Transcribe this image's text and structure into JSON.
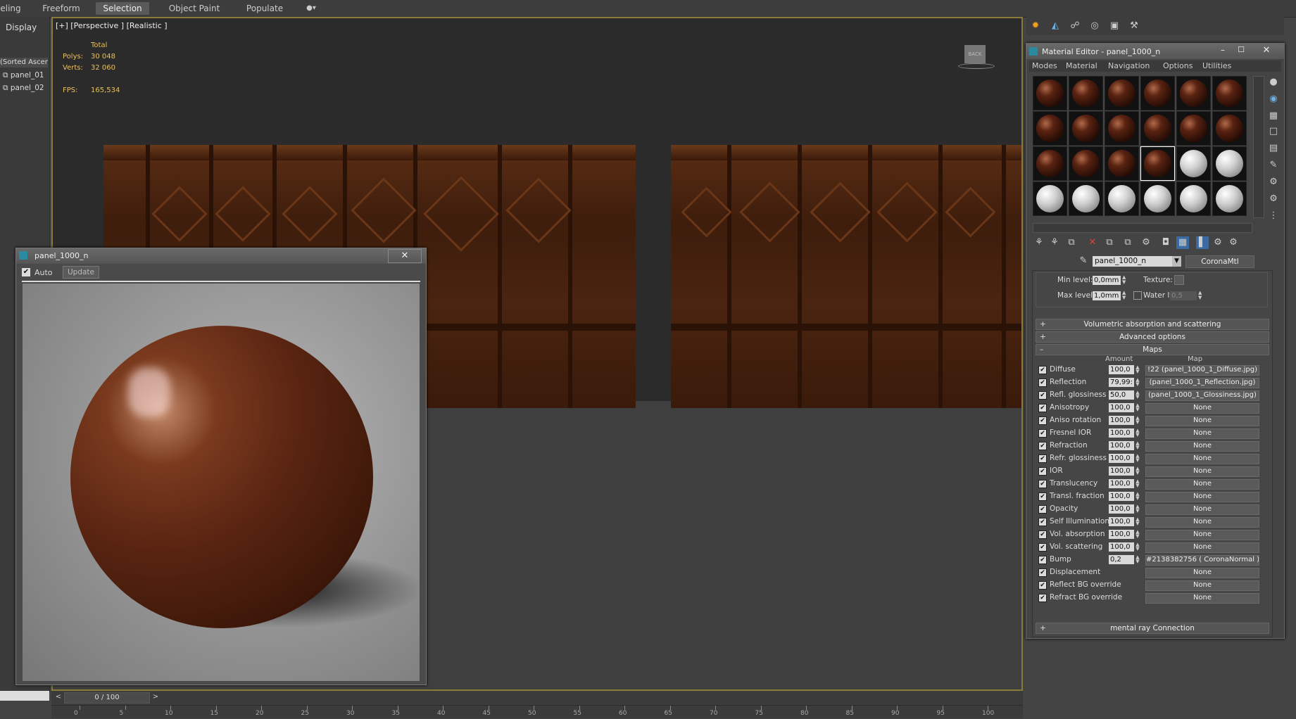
{
  "ribbon": {
    "tabs": [
      "eling",
      "Freeform",
      "Selection",
      "Object Paint",
      "Populate"
    ]
  },
  "left_panel": {
    "display_label": "Display",
    "sort_label": "(Sorted Ascen",
    "items": [
      "panel_01",
      "panel_02"
    ]
  },
  "viewport": {
    "label": "[+] [Perspective ] [Realistic ]",
    "stats": {
      "total_label": "Total",
      "polys_label": "Polys:",
      "polys_value": "30 048",
      "verts_label": "Verts:",
      "verts_value": "32 060",
      "fps_label": "FPS:",
      "fps_value": "165,534"
    },
    "viewcube_label": "BACK"
  },
  "render_window": {
    "title": "panel_1000_n",
    "auto_label": "Auto",
    "update_label": "Update"
  },
  "material_editor": {
    "title": "Material Editor - panel_1000_n",
    "menu": [
      "Modes",
      "Material",
      "Navigation",
      "Options",
      "Utilities"
    ],
    "slot_types": [
      "wood",
      "wood",
      "wood",
      "wood",
      "wood",
      "wood",
      "wood",
      "wood",
      "wood",
      "wood",
      "wood",
      "wood",
      "wood",
      "wood",
      "wood",
      "wood",
      "white",
      "white",
      "white",
      "white",
      "white",
      "white",
      "white",
      "white"
    ],
    "material_name": "panel_1000_n",
    "material_type": "CoronaMtl",
    "min_level_label": "Min level:",
    "min_level_value": "0,0mm",
    "max_level_label": "Max level:",
    "max_level_value": "1,0mm",
    "texture_label": "Texture:",
    "water_label": "Water lvl.",
    "water_value": "0,5",
    "rollouts": {
      "volumetric": "Volumetric absorption and scattering",
      "advanced": "Advanced options",
      "maps": "Maps",
      "mental_ray": "mental ray Connection"
    },
    "maps_header": {
      "amount": "Amount",
      "map": "Map"
    },
    "maps": [
      {
        "label": "Diffuse",
        "amount": "100,0",
        "map": "!22 (panel_1000_1_Diffuse.jpg)"
      },
      {
        "label": "Reflection",
        "amount": "79,99:",
        "map": "(panel_1000_1_Reflection.jpg)"
      },
      {
        "label": "Refl. glossiness",
        "amount": "50,0",
        "map": "(panel_1000_1_Glossiness.jpg)"
      },
      {
        "label": "Anisotropy",
        "amount": "100,0",
        "map": "None"
      },
      {
        "label": "Aniso rotation",
        "amount": "100,0",
        "map": "None"
      },
      {
        "label": "Fresnel IOR",
        "amount": "100,0",
        "map": "None"
      },
      {
        "label": "Refraction",
        "amount": "100,0",
        "map": "None"
      },
      {
        "label": "Refr. glossiness",
        "amount": "100,0",
        "map": "None"
      },
      {
        "label": "IOR",
        "amount": "100,0",
        "map": "None"
      },
      {
        "label": "Translucency",
        "amount": "100,0",
        "map": "None"
      },
      {
        "label": "Transl. fraction",
        "amount": "100,0",
        "map": "None"
      },
      {
        "label": "Opacity",
        "amount": "100,0",
        "map": "None"
      },
      {
        "label": "Self Illumination",
        "amount": "100,0",
        "map": "None"
      },
      {
        "label": "Vol. absorption",
        "amount": "100,0",
        "map": "None"
      },
      {
        "label": "Vol. scattering",
        "amount": "100,0",
        "map": "None"
      },
      {
        "label": "Bump",
        "amount": "0,2",
        "map": "#2138382756 ( CoronaNormal )"
      },
      {
        "label": "Displacement",
        "amount": "",
        "map": "None"
      },
      {
        "label": "Reflect BG override",
        "amount": "",
        "map": "None"
      },
      {
        "label": "Refract BG override",
        "amount": "",
        "map": "None"
      }
    ]
  },
  "timeline": {
    "frame_label": "0 / 100",
    "ticks": [
      "0",
      "5",
      "10",
      "15",
      "20",
      "25",
      "30",
      "35",
      "40",
      "45",
      "50",
      "55",
      "60",
      "65",
      "70",
      "75",
      "80",
      "85",
      "90",
      "95",
      "100"
    ]
  }
}
